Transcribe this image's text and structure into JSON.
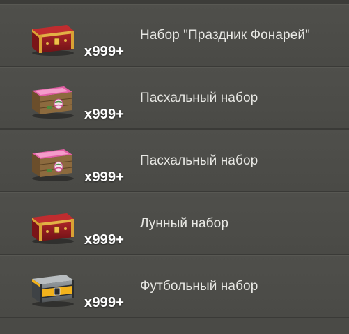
{
  "items": [
    {
      "title": "Набор \"Праздник Фонарей\"",
      "count": "x999+",
      "icon": "red-lantern-chest-icon",
      "colors": {
        "body": "#8e1c20",
        "trim": "#d9a234"
      }
    },
    {
      "title": "Пасхальный набор",
      "count": "x999+",
      "icon": "easter-crate-icon",
      "colors": {
        "body": "#8c6a3e",
        "trim": "#e25fa5"
      }
    },
    {
      "title": "Пасхальный набор",
      "count": "x999+",
      "icon": "easter-crate-icon",
      "colors": {
        "body": "#8c6a3e",
        "trim": "#e25fa5"
      }
    },
    {
      "title": "Лунный набор",
      "count": "x999+",
      "icon": "red-lunar-chest-icon",
      "colors": {
        "body": "#8e1c20",
        "trim": "#d9a234"
      }
    },
    {
      "title": "Футбольный набор",
      "count": "x999+",
      "icon": "football-chest-icon",
      "colors": {
        "body": "#6b6f72",
        "trim": "#f2b21c"
      }
    }
  ]
}
